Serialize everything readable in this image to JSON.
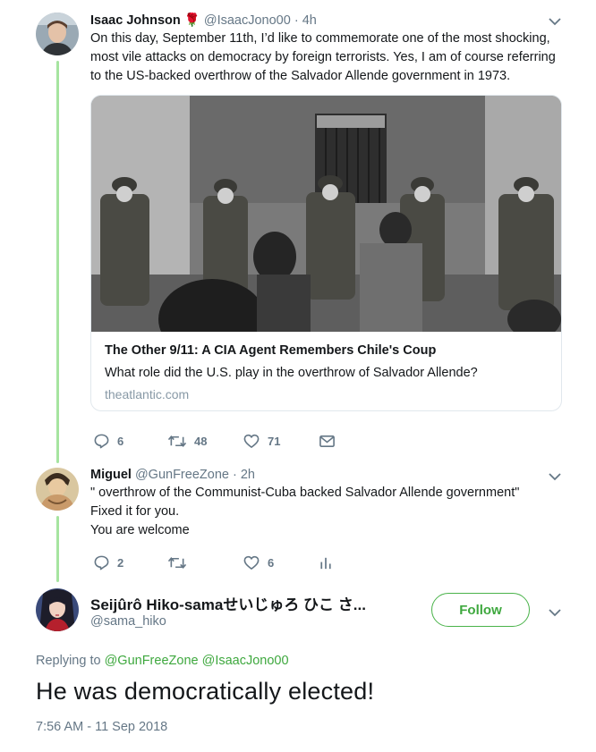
{
  "tweet1": {
    "name": "Isaac Johnson",
    "emoji": "🌹",
    "handle": "@IsaacJono00",
    "sep": "·",
    "time": "4h",
    "text_lines": [
      "On this day, September 11th, I’d like to commemorate one of the most shocking,",
      "most vile attacks on democracy by foreign terrorists. Yes, I am of course referring",
      "to the US-backed overthrow of the Salvador Allende government in 1973."
    ],
    "card": {
      "title": "The Other 9/11: A CIA Agent Remembers Chile's Coup",
      "description": "What role did the U.S. play in the overthrow of Salvador Allende?",
      "domain": "theatlantic.com",
      "image_icon": "photo-soldiers-icon"
    },
    "replies": "6",
    "retweets": "48",
    "likes": "71"
  },
  "tweet2": {
    "name": "Miguel",
    "handle": "@GunFreeZone",
    "sep": "·",
    "time": "2h",
    "text_lines": [
      "\" overthrow of the Communist-Cuba backed Salvador Allende government\"",
      "Fixed it for you.",
      "You are welcome"
    ],
    "replies": "2",
    "likes": "6"
  },
  "tweet3": {
    "name": "Seijûrô Hiko-samaせいじゅろ ひこ さ...",
    "handle": "@sama_hiko",
    "follow_label": "Follow",
    "replying_prefix": "Replying to",
    "mention1": "@GunFreeZone",
    "mention2": "@IsaacJono00",
    "text": "He was democratically elected!",
    "timestamp": "7:56 AM - 11 Sep 2018"
  },
  "colors": {
    "accent": "#3ea83e",
    "thread_line": "#a6e4a0",
    "muted": "#657786",
    "card_border": "#e1e8ed"
  }
}
